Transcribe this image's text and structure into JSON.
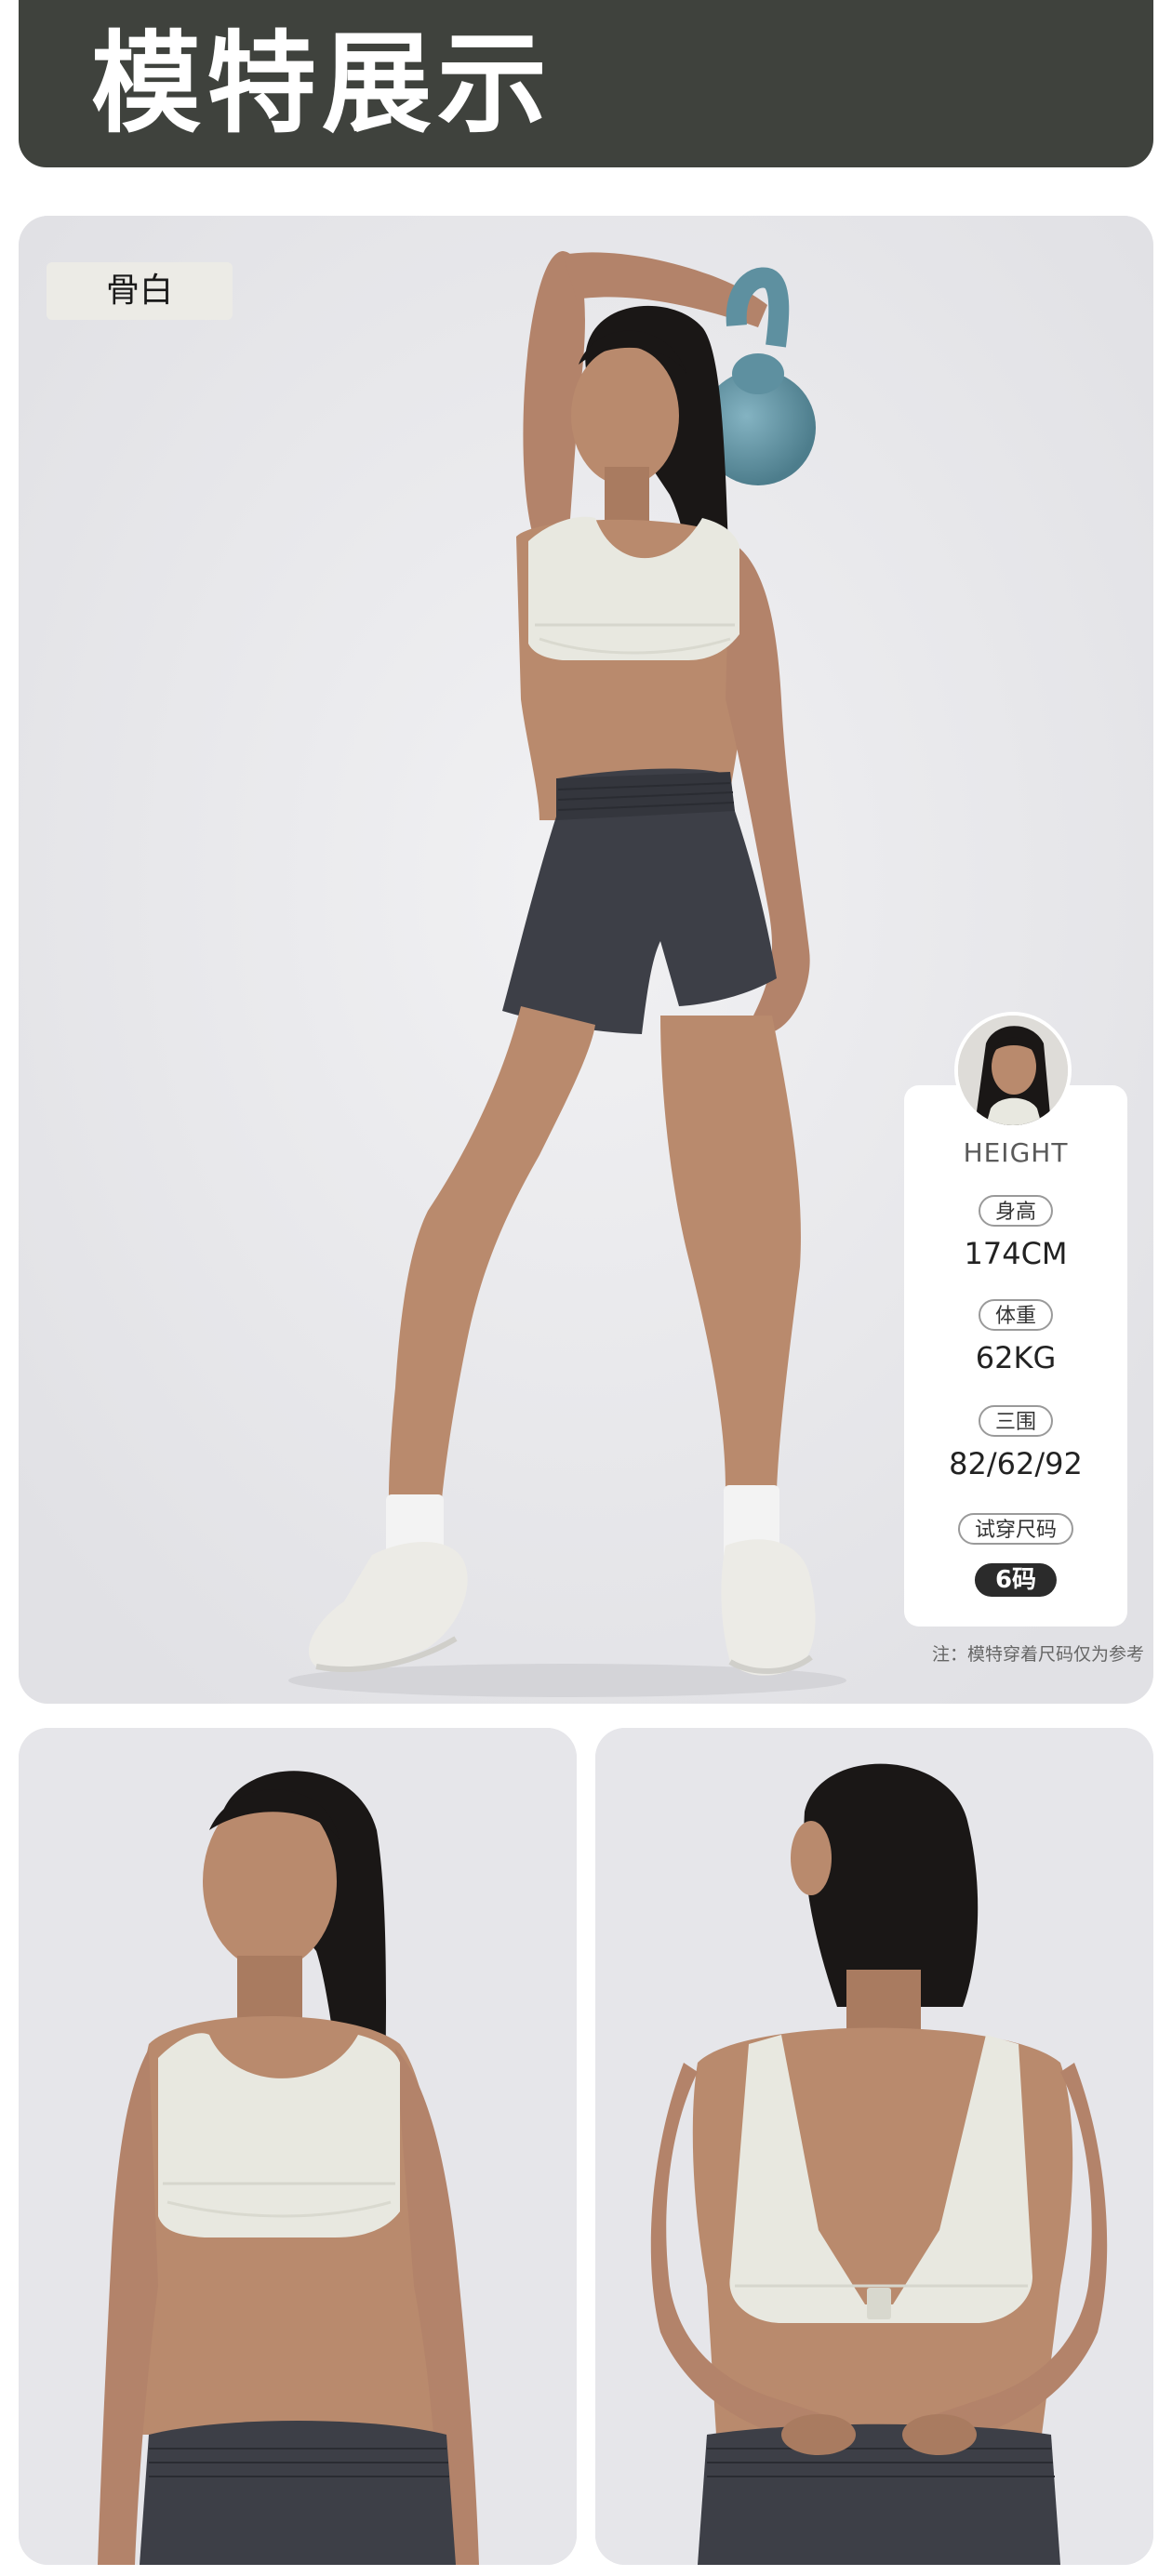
{
  "header": {
    "title": "模特展示",
    "bg_color": "#3f423d"
  },
  "main_photo": {
    "color_tag": "骨白",
    "image_desc": "model-full-body-kettlebell",
    "background": "#e9e9ec"
  },
  "model_card": {
    "height_label": "HEIGHT",
    "height_key": "身高",
    "height_value": "174CM",
    "weight_key": "体重",
    "weight_value": "62KG",
    "measurements_key": "三围",
    "measurements_value": "82/62/92",
    "fit_size_key": "试穿尺码",
    "fit_size_value": "6码"
  },
  "note": "注：模特穿着尺码仅为参考",
  "detail_photos": {
    "front_background": "#e6e6ea",
    "back_background": "#e6e6ea"
  },
  "colors": {
    "bra": "#e8e8e0",
    "shorts": "#3d3f47",
    "skin": "#b98a6d",
    "hair": "#1a1716",
    "kettlebell": "#5e90a0",
    "sneaker": "#ecebe6"
  }
}
